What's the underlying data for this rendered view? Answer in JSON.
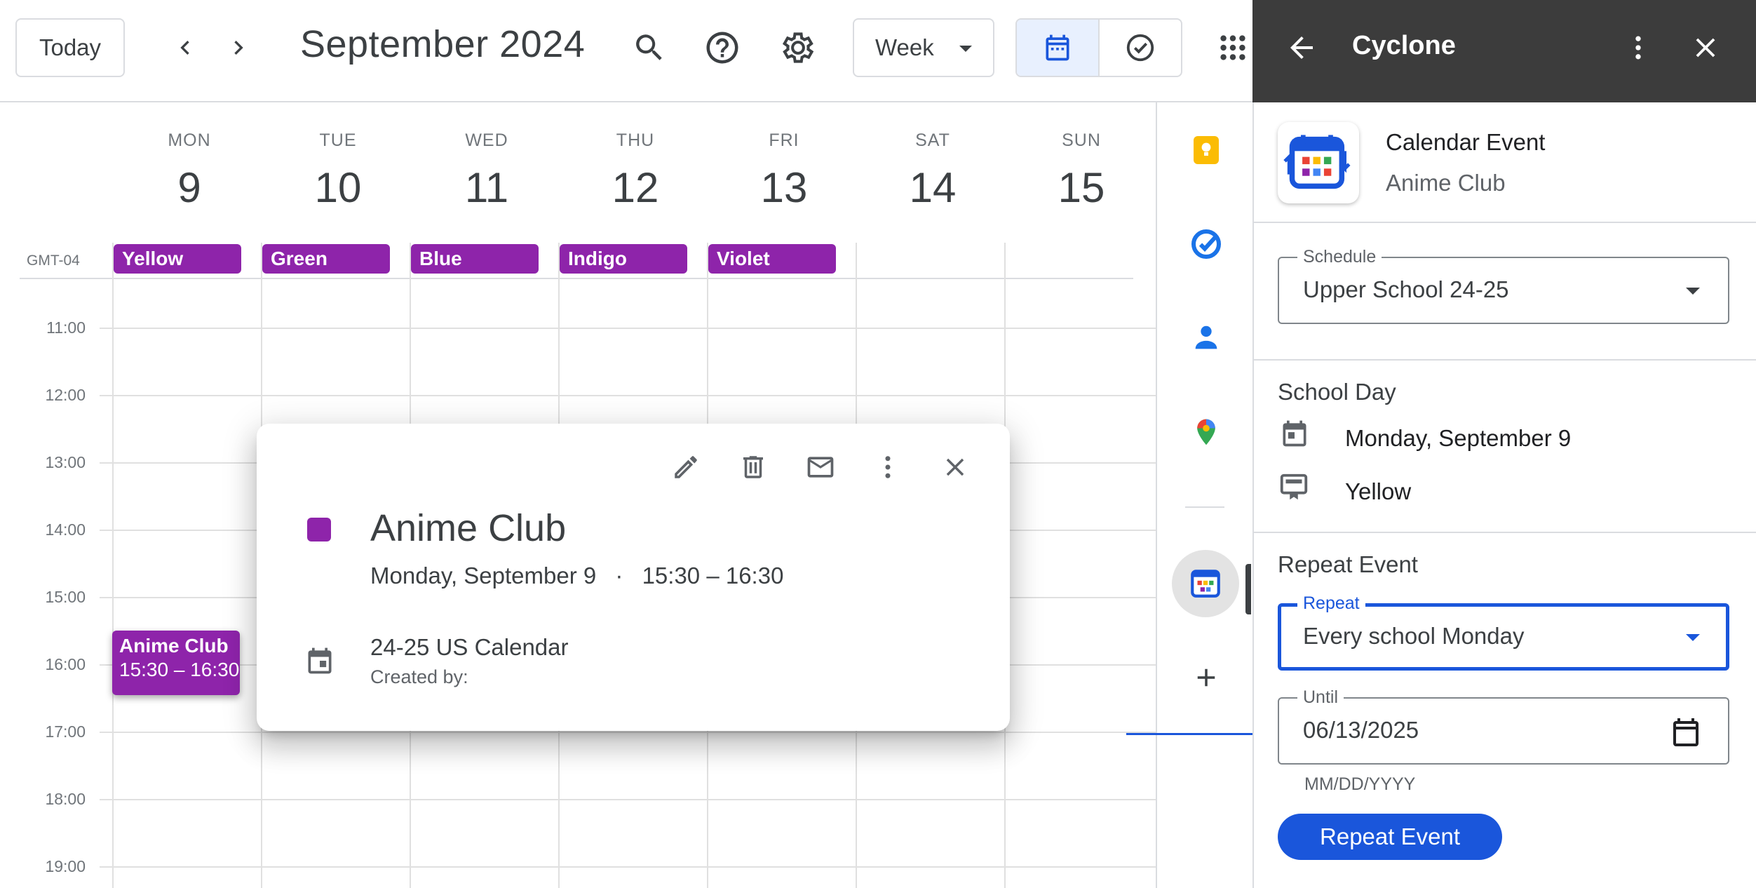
{
  "header": {
    "today_label": "Today",
    "month_title": "September 2024",
    "view_select": "Week"
  },
  "calendar": {
    "timezone": "GMT-04",
    "days": [
      {
        "dow": "MON",
        "num": "9"
      },
      {
        "dow": "TUE",
        "num": "10"
      },
      {
        "dow": "WED",
        "num": "11"
      },
      {
        "dow": "THU",
        "num": "12"
      },
      {
        "dow": "FRI",
        "num": "13"
      },
      {
        "dow": "SAT",
        "num": "14"
      },
      {
        "dow": "SUN",
        "num": "15"
      }
    ],
    "allday_events": [
      "Yellow",
      "Green",
      "Blue",
      "Indigo",
      "Violet"
    ],
    "hours": [
      "11:00",
      "12:00",
      "13:00",
      "14:00",
      "15:00",
      "16:00",
      "17:00",
      "18:00",
      "19:00"
    ],
    "event": {
      "title": "Anime Club",
      "time": "15:30 – 16:30"
    }
  },
  "popup": {
    "title": "Anime Club",
    "date": "Monday, September 9",
    "separator": "·",
    "time": "15:30 – 16:30",
    "calendar_name": "24-25 US Calendar",
    "created_by": "Created by:"
  },
  "panel": {
    "title": "Cyclone",
    "card_type": "Calendar Event",
    "card_name": "Anime Club",
    "schedule_label": "Schedule",
    "schedule_value": "Upper School 24-25",
    "school_day_title": "School Day",
    "school_day_date": "Monday, September 9",
    "school_day_color": "Yellow",
    "repeat_title": "Repeat Event",
    "repeat_label": "Repeat",
    "repeat_value": "Every school Monday",
    "until_label": "Until",
    "until_value": "06/13/2025",
    "until_hint": "MM/DD/YYYY",
    "repeat_button": "Repeat Event"
  },
  "colors": {
    "event_purple": "#8e24aa",
    "panel_header": "#3c3c3c",
    "accent_blue": "#1a56db"
  }
}
